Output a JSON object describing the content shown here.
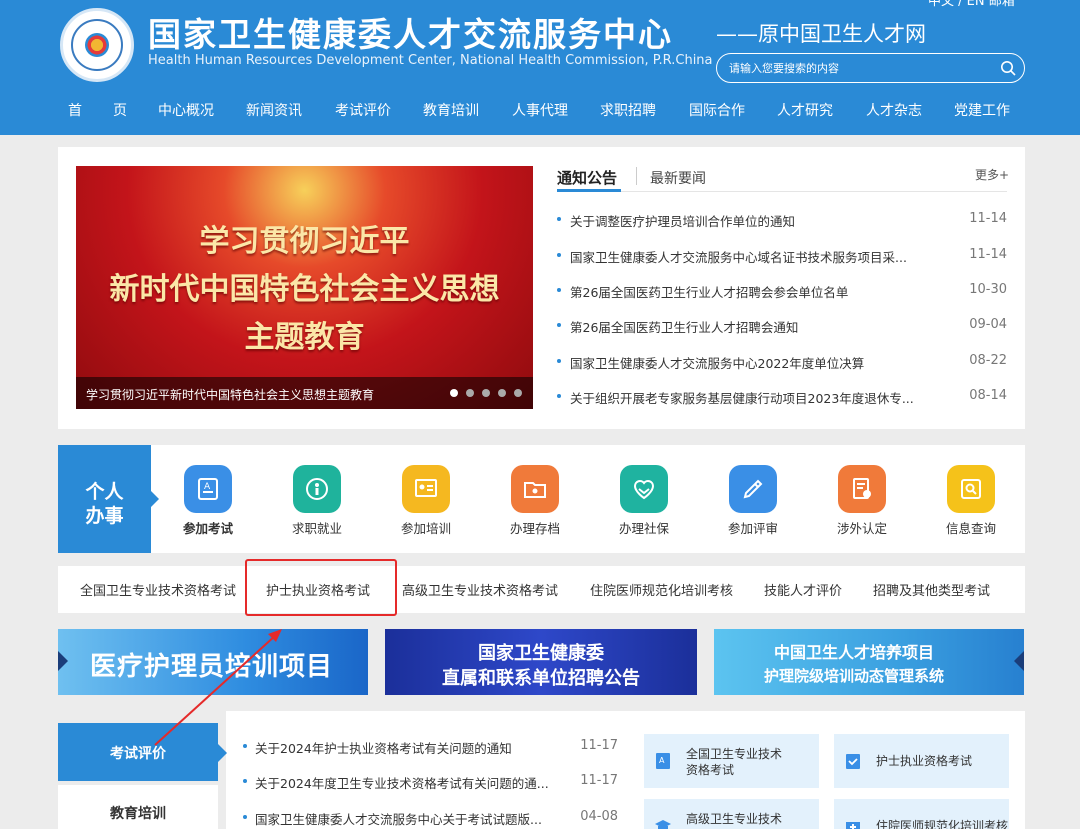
{
  "header": {
    "title_cn": "国家卫生健康委人才交流服务中心",
    "title_en": "Health Human Resources Development Center, National Health Commission, P.R.China",
    "subtitle": "——原中国卫生人才网",
    "top_links": "中文 / EN  邮箱",
    "search": {
      "placeholder": "请输入您要搜索的内容"
    }
  },
  "nav": [
    "首",
    "页",
    "中心概况",
    "新闻资讯",
    "考试评价",
    "教育培训",
    "人事代理",
    "求职招聘",
    "国际合作",
    "人才研究",
    "人才杂志",
    "党建工作"
  ],
  "slider": {
    "line1": "学习贯彻习近平",
    "line2": "新时代中国特色社会主义思想",
    "line3": "主题教育",
    "caption": "学习贯彻习近平新时代中国特色社会主义思想主题教育",
    "dots": 5,
    "active_dot": 0
  },
  "notice": {
    "tab_active": "通知公告",
    "tab_other": "最新要闻",
    "more": "更多+",
    "items": [
      {
        "title": "关于调整医疗护理员培训合作单位的通知",
        "date": "11-14"
      },
      {
        "title": "国家卫生健康委人才交流服务中心域名证书技术服务项目采...",
        "date": "11-14"
      },
      {
        "title": "第26届全国医药卫生行业人才招聘会参会单位名单",
        "date": "10-30"
      },
      {
        "title": "第26届全国医药卫生行业人才招聘会通知",
        "date": "09-04"
      },
      {
        "title": "国家卫生健康委人才交流服务中心2022年度单位决算",
        "date": "08-22"
      },
      {
        "title": "关于组织开展老专家服务基层健康行动项目2023年度退休专...",
        "date": "08-14"
      }
    ]
  },
  "personal": {
    "line1": "个人",
    "line2": "办事"
  },
  "services": [
    {
      "label": "参加考试",
      "icon": "exam-icon",
      "color": "#3a8fe6"
    },
    {
      "label": "求职就业",
      "icon": "job-icon",
      "color": "#1fb39c"
    },
    {
      "label": "参加培训",
      "icon": "training-icon",
      "color": "#f5b820"
    },
    {
      "label": "办理存档",
      "icon": "archive-icon",
      "color": "#f07a3a"
    },
    {
      "label": "办理社保",
      "icon": "social-security-icon",
      "color": "#1fb3a0"
    },
    {
      "label": "参加评审",
      "icon": "review-icon",
      "color": "#3a8fe6"
    },
    {
      "label": "涉外认定",
      "icon": "foreign-cert-icon",
      "color": "#f07a3a"
    },
    {
      "label": "信息查询",
      "icon": "info-query-icon",
      "color": "#f5c21a"
    }
  ],
  "exam_categories": [
    "全国卫生专业技术资格考试",
    "护士执业资格考试",
    "高级卫生专业技术资格考试",
    "住院医师规范化培训考核",
    "技能人才评价",
    "招聘及其他类型考试"
  ],
  "banners": {
    "b1": "医疗护理员培训项目",
    "b2_line1": "国家卫生健康委",
    "b2_line2": "直属和联系单位招聘公告",
    "b3_line1": "中国卫生人才培养项目",
    "b3_line2": "护理院级培训动态管理系统"
  },
  "side": {
    "active": "考试评价",
    "other": "教育培训"
  },
  "exam_news": [
    {
      "title": "关于2024年护士执业资格考试有关问题的通知",
      "date": "11-17"
    },
    {
      "title": "关于2024年度卫生专业技术资格考试有关问题的通...",
      "date": "11-17"
    },
    {
      "title": "国家卫生健康委人才交流服务中心关于考试试题版...",
      "date": "04-08"
    }
  ],
  "cards": [
    {
      "line1": "全国卫生专业技术",
      "line2": "资格考试"
    },
    {
      "line1": "护士执业资格考试",
      "line2": ""
    },
    {
      "line1": "高级卫生专业技术",
      "line2": ""
    },
    {
      "line1": "住院医师规范化培训考核",
      "line2": ""
    }
  ],
  "colors": {
    "primary": "#2a8ad6",
    "highlight_box": "#e52a2a"
  }
}
